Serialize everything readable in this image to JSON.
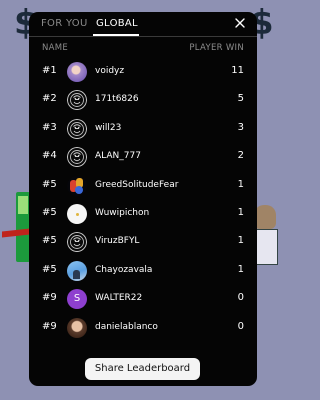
{
  "tabs": [
    {
      "label": "FOR YOU"
    },
    {
      "label": "GLOBAL"
    }
  ],
  "columns": {
    "name": "NAME",
    "wins": "PLAYER WIN"
  },
  "rows": [
    {
      "rank": "#1",
      "name": "voidyz",
      "wins": "11",
      "avatar": "purple-photo"
    },
    {
      "rank": "#2",
      "name": "171t6826",
      "wins": "5",
      "avatar": "crest-icon"
    },
    {
      "rank": "#3",
      "name": "will23",
      "wins": "3",
      "avatar": "crest-icon"
    },
    {
      "rank": "#4",
      "name": "ALAN_777",
      "wins": "2",
      "avatar": "crest-icon"
    },
    {
      "rank": "#5",
      "name": "GreedSolitudeFear",
      "wins": "1",
      "avatar": "colorful-art"
    },
    {
      "rank": "#5",
      "name": "Wuwipichon",
      "wins": "1",
      "avatar": "white-blob"
    },
    {
      "rank": "#5",
      "name": "ViruzBFYL",
      "wins": "1",
      "avatar": "crest-icon"
    },
    {
      "rank": "#5",
      "name": "Chayozavala",
      "wins": "1",
      "avatar": "sky-photo"
    },
    {
      "rank": "#9",
      "name": "WALTER22",
      "wins": "0",
      "avatar": "letter-S",
      "letter": "S"
    },
    {
      "rank": "#9",
      "name": "danielablanco",
      "wins": "0",
      "avatar": "portrait-photo"
    }
  ],
  "share_button": "Share Leaderboard",
  "colors": {
    "modal_bg": "#050505",
    "page_bg": "#8e91b3",
    "letter_avatar": "#8e3fcf"
  }
}
